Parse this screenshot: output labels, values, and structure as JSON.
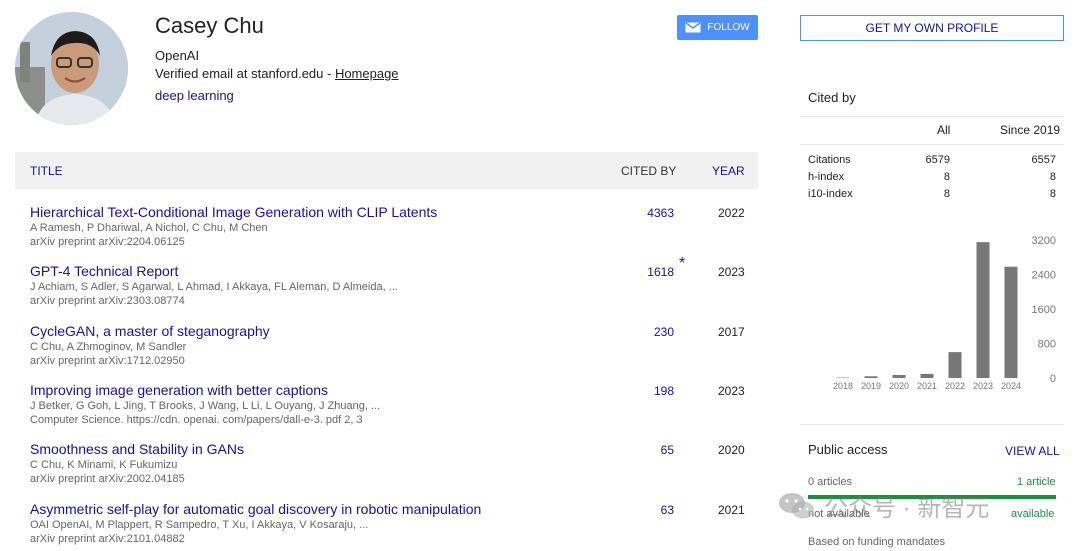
{
  "profile": {
    "name": "Casey Chu",
    "affiliation": "OpenAI",
    "verified_prefix": "Verified email at stanford.edu - ",
    "homepage_label": "Homepage",
    "interest": "deep learning",
    "follow_label": "FOLLOW"
  },
  "table": {
    "headers": {
      "title": "TITLE",
      "cited_by": "CITED BY",
      "year": "YEAR"
    },
    "rows": [
      {
        "title": "Hierarchical Text-Conditional Image Generation with CLIP Latents",
        "authors": "A Ramesh, P Dhariwal, A Nichol, C Chu, M Chen",
        "venue": "arXiv preprint arXiv:2204.06125",
        "cited_by": "4363",
        "year": "2022",
        "star": ""
      },
      {
        "title": "GPT-4 Technical Report",
        "authors": "J Achiam, S Adler, S Agarwal, L Ahmad, I Akkaya, FL Aleman, D Almeida, ...",
        "venue": "arXiv preprint arXiv:2303.08774",
        "cited_by": "1618",
        "year": "2023",
        "star": "*"
      },
      {
        "title": "CycleGAN, a master of steganography",
        "authors": "C Chu, A Zhmoginov, M Sandler",
        "venue": "arXiv preprint arXiv:1712.02950",
        "cited_by": "230",
        "year": "2017",
        "star": ""
      },
      {
        "title": "Improving image generation with better captions",
        "authors": "J Betker, G Goh, L Jing, T Brooks, J Wang, L Li, L Ouyang, J Zhuang, ...",
        "venue": "Computer Science. https://cdn. openai. com/papers/dall-e-3. pdf 2, 3",
        "cited_by": "198",
        "year": "2023",
        "star": ""
      },
      {
        "title": "Smoothness and Stability in GANs",
        "authors": "C Chu, K Minami, K Fukumizu",
        "venue": "arXiv preprint arXiv:2002.04185",
        "cited_by": "65",
        "year": "2020",
        "star": ""
      },
      {
        "title": "Asymmetric self-play for automatic goal discovery in robotic manipulation",
        "authors": "OAI OpenAI, M Plappert, R Sampedro, T Xu, I Akkaya, V Kosaraju, ...",
        "venue": "arXiv preprint arXiv:2101.04882",
        "cited_by": "63",
        "year": "2021",
        "star": ""
      }
    ]
  },
  "sidebar": {
    "own_profile_label": "GET MY OWN PROFILE",
    "cited_by_title": "Cited by",
    "col_all": "All",
    "col_since": "Since 2019",
    "metrics": [
      {
        "label": "Citations",
        "all": "6579",
        "since": "6557"
      },
      {
        "label": "h-index",
        "all": "8",
        "since": "8"
      },
      {
        "label": "i10-index",
        "all": "8",
        "since": "8"
      }
    ],
    "public_access": {
      "title": "Public access",
      "view_all": "VIEW ALL",
      "articles_left": "0 articles",
      "articles_right": "1 article",
      "not_available": "not available",
      "available": "available",
      "funding": "Based on funding mandates"
    }
  },
  "chart_data": {
    "type": "bar",
    "categories": [
      "2018",
      "2019",
      "2020",
      "2021",
      "2022",
      "2023",
      "2024"
    ],
    "values": [
      10,
      40,
      70,
      95,
      600,
      3150,
      2580
    ],
    "yticks": [
      "0",
      "800",
      "1600",
      "2400",
      "3200"
    ],
    "ylim": [
      0,
      3200
    ],
    "title": "",
    "xlabel": "",
    "ylabel": "",
    "bar_color": "#777777"
  },
  "watermark": {
    "text": "公众号 · 新智元"
  },
  "colors": {
    "link": "#1a0dab",
    "accent": "#4d90fe",
    "green": "#1e8e3e"
  }
}
